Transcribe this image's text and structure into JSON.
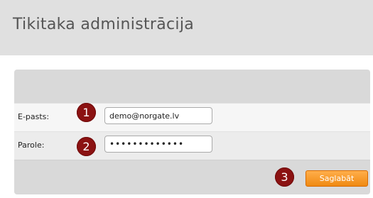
{
  "header": {
    "title": "Tikitaka administrācija"
  },
  "form": {
    "email_label": "E-pasts:",
    "email_value": "demo@norgate.lv",
    "password_label": "Parole:",
    "password_value": "•••••••••••••",
    "save_label": "Saglabāt"
  },
  "steps": [
    "1",
    "2",
    "3"
  ],
  "colors": {
    "header_bg": "#e0e0e0",
    "panel_bg": "#d9d9d9",
    "step_badge": "#8b1212",
    "save_button": "#f5901c"
  }
}
